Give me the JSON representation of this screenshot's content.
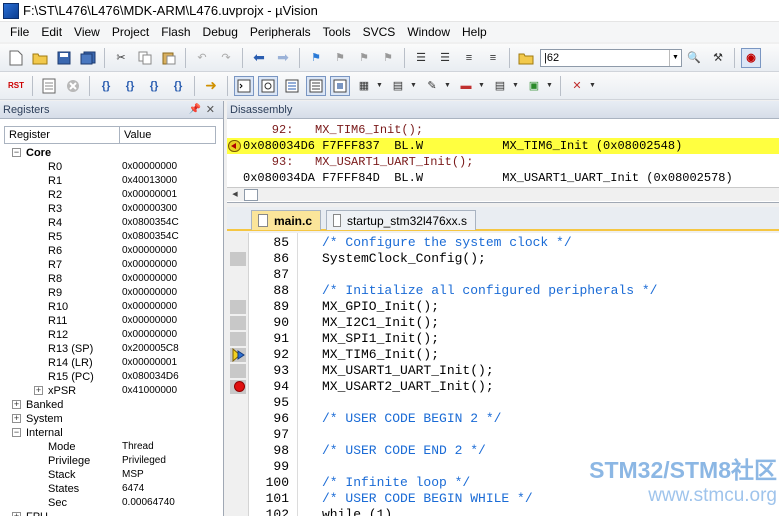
{
  "window": {
    "title": "F:\\ST\\L476\\L476\\MDK-ARM\\L476.uvprojx - µVision"
  },
  "menu": [
    "File",
    "Edit",
    "View",
    "Project",
    "Flash",
    "Debug",
    "Peripherals",
    "Tools",
    "SVCS",
    "Window",
    "Help"
  ],
  "toolbar": {
    "search_value": "|62"
  },
  "registers": {
    "title": "Registers",
    "col_register": "Register",
    "col_value": "Value",
    "core_label": "Core",
    "core": [
      {
        "name": "R0",
        "value": "0x00000000"
      },
      {
        "name": "R1",
        "value": "0x40013000"
      },
      {
        "name": "R2",
        "value": "0x00000001"
      },
      {
        "name": "R3",
        "value": "0x00000300"
      },
      {
        "name": "R4",
        "value": "0x0800354C"
      },
      {
        "name": "R5",
        "value": "0x0800354C"
      },
      {
        "name": "R6",
        "value": "0x00000000"
      },
      {
        "name": "R7",
        "value": "0x00000000"
      },
      {
        "name": "R8",
        "value": "0x00000000"
      },
      {
        "name": "R9",
        "value": "0x00000000"
      },
      {
        "name": "R10",
        "value": "0x00000000"
      },
      {
        "name": "R11",
        "value": "0x00000000"
      },
      {
        "name": "R12",
        "value": "0x00000000"
      },
      {
        "name": "R13 (SP)",
        "value": "0x200005C8"
      },
      {
        "name": "R14 (LR)",
        "value": "0x00000001"
      },
      {
        "name": "R15 (PC)",
        "value": "0x080034D6"
      },
      {
        "name": "xPSR",
        "value": "0x41000000"
      }
    ],
    "groups": [
      "Banked",
      "System",
      "Internal"
    ],
    "internal": [
      {
        "name": "Mode",
        "value": "Thread"
      },
      {
        "name": "Privilege",
        "value": "Privileged"
      },
      {
        "name": "Stack",
        "value": "MSP"
      },
      {
        "name": "States",
        "value": "6474"
      },
      {
        "name": "Sec",
        "value": "0.00064740"
      }
    ],
    "last_group": "FPU"
  },
  "disassembly": {
    "title": "Disassembly",
    "lines": [
      {
        "kind": "src",
        "text": "    92:   MX_TIM6_Init();"
      },
      {
        "kind": "cur",
        "text": "0x080034D6 F7FFF837  BL.W           MX_TIM6_Init (0x08002548)"
      },
      {
        "kind": "src",
        "text": "    93:   MX_USART1_UART_Init();"
      },
      {
        "kind": "asm",
        "text": "0x080034DA F7FFF84D  BL.W           MX_USART1_UART_Init (0x08002578)"
      }
    ]
  },
  "tabs": [
    {
      "label": "main.c",
      "active": true
    },
    {
      "label": "startup_stm32l476xx.s",
      "active": false
    }
  ],
  "code": [
    {
      "num": "85",
      "text": "/* Configure the system clock */",
      "comment": true,
      "mark": ""
    },
    {
      "num": "86",
      "text": "SystemClock_Config();",
      "comment": false,
      "mark": "exec"
    },
    {
      "num": "87",
      "text": "",
      "comment": false,
      "mark": ""
    },
    {
      "num": "88",
      "text": "/* Initialize all configured peripherals */",
      "comment": true,
      "mark": ""
    },
    {
      "num": "89",
      "text": "MX_GPIO_Init();",
      "comment": false,
      "mark": "exec"
    },
    {
      "num": "90",
      "text": "MX_I2C1_Init();",
      "comment": false,
      "mark": "exec"
    },
    {
      "num": "91",
      "text": "MX_SPI1_Init();",
      "comment": false,
      "mark": "exec"
    },
    {
      "num": "92",
      "text": "MX_TIM6_Init();",
      "comment": false,
      "mark": "current"
    },
    {
      "num": "93",
      "text": "MX_USART1_UART_Init();",
      "comment": false,
      "mark": "exec"
    },
    {
      "num": "94",
      "text": "MX_USART2_UART_Init();",
      "comment": false,
      "mark": "breakpoint"
    },
    {
      "num": "95",
      "text": "",
      "comment": false,
      "mark": ""
    },
    {
      "num": "96",
      "text": "/* USER CODE BEGIN 2 */",
      "comment": true,
      "mark": ""
    },
    {
      "num": "97",
      "text": "",
      "comment": false,
      "mark": ""
    },
    {
      "num": "98",
      "text": "/* USER CODE END 2 */",
      "comment": true,
      "mark": ""
    },
    {
      "num": "99",
      "text": "",
      "comment": false,
      "mark": ""
    },
    {
      "num": "100",
      "text": "/* Infinite loop */",
      "comment": true,
      "mark": ""
    },
    {
      "num": "101",
      "text": "/* USER CODE BEGIN WHILE */",
      "comment": true,
      "mark": ""
    },
    {
      "num": "102",
      "text": "while (1)",
      "comment": false,
      "mark": ""
    }
  ],
  "watermark": {
    "line1": "STM32/STM8社区",
    "line2": "www.stmcu.org"
  },
  "colors": {
    "current_line": "#ffff40",
    "comment": "#1a6bd6",
    "breakpoint": "#e01010",
    "tab_active": "#fbe59a"
  }
}
